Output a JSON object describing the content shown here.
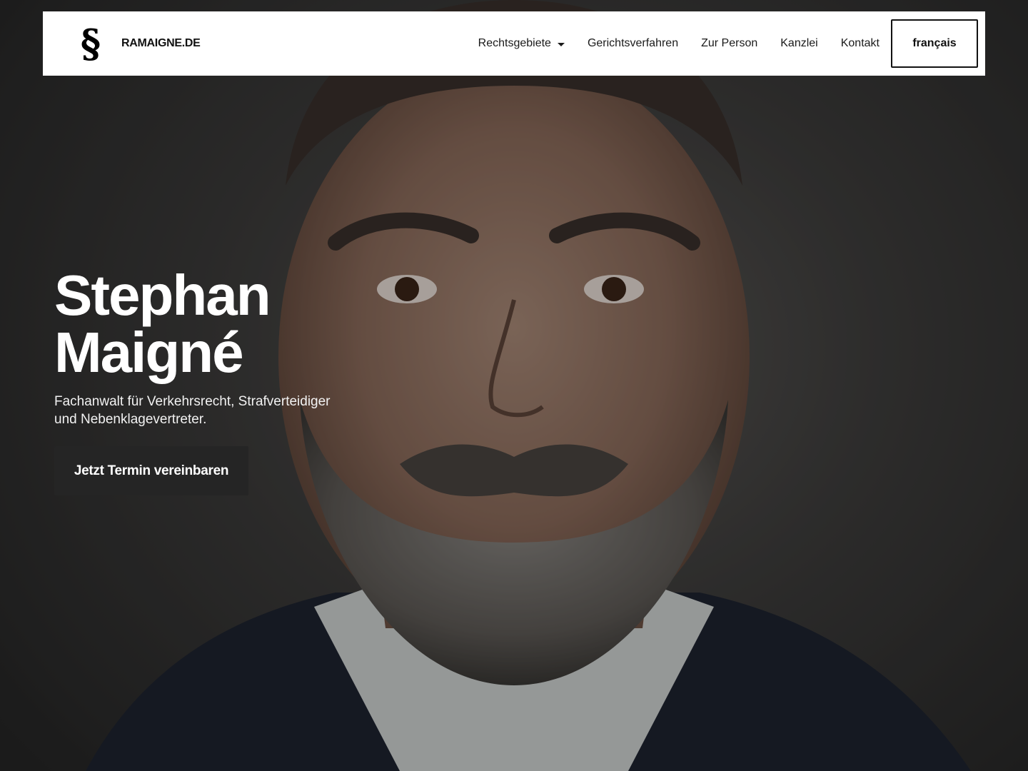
{
  "header": {
    "logo_symbol": "§",
    "brand_name": "RAMAIGNE.DE",
    "nav_items": [
      {
        "label": "Rechtsgebiete",
        "has_dropdown": true
      },
      {
        "label": "Gerichtsverfahren"
      },
      {
        "label": "Zur Person"
      },
      {
        "label": "Kanzlei"
      },
      {
        "label": "Kontakt"
      }
    ],
    "language_button": "français"
  },
  "hero": {
    "title_line1": "Stephan",
    "title_line2": "Maigné",
    "subtitle": "Fachanwalt für Verkehrsrecht, Strafverteidiger und Nebenklagevertreter.",
    "cta_label": "Jetzt Termin vereinbaren"
  },
  "colors": {
    "navbar_bg": "#ffffff",
    "cta_bg": "#252525",
    "hero_text": "#ffffff"
  }
}
